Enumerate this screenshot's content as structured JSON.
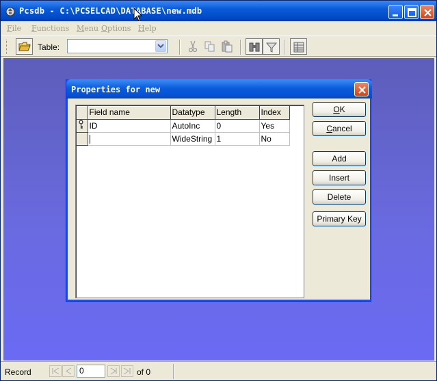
{
  "window": {
    "title": "Pcsdb - C:\\PCSELCAD\\DATABASE\\new.mdb"
  },
  "menu": {
    "items": [
      {
        "label": "File",
        "accel": "F",
        "rest": "ile"
      },
      {
        "label": "Functions",
        "accel": "F",
        "rest": "unctions"
      },
      {
        "label": "Menu",
        "accel": "M",
        "rest": "enu"
      },
      {
        "label": "Options",
        "accel": "O",
        "rest": "ptions"
      },
      {
        "label": "Help",
        "accel": "H",
        "rest": "elp"
      }
    ]
  },
  "toolbar": {
    "table_label": "Table:",
    "table_value": ""
  },
  "status": {
    "record_label": "Record",
    "record_value": "0",
    "of_label": "of 0"
  },
  "dialog": {
    "title": "Properties for new",
    "columns": [
      "Field name",
      "Datatype",
      "Length",
      "Index"
    ],
    "rows": [
      {
        "key": true,
        "field": "ID",
        "type": "AutoInc",
        "length": "0",
        "index": "Yes"
      },
      {
        "key": false,
        "field": "",
        "type": "WideString",
        "length": "1",
        "index": "No"
      }
    ],
    "buttons": {
      "ok": {
        "accel": "O",
        "rest": "K"
      },
      "cancel": {
        "accel": "C",
        "rest": "ancel"
      },
      "add": "Add",
      "insert": "Insert",
      "delete": "Delete",
      "primary_key": "Primary Key"
    }
  }
}
